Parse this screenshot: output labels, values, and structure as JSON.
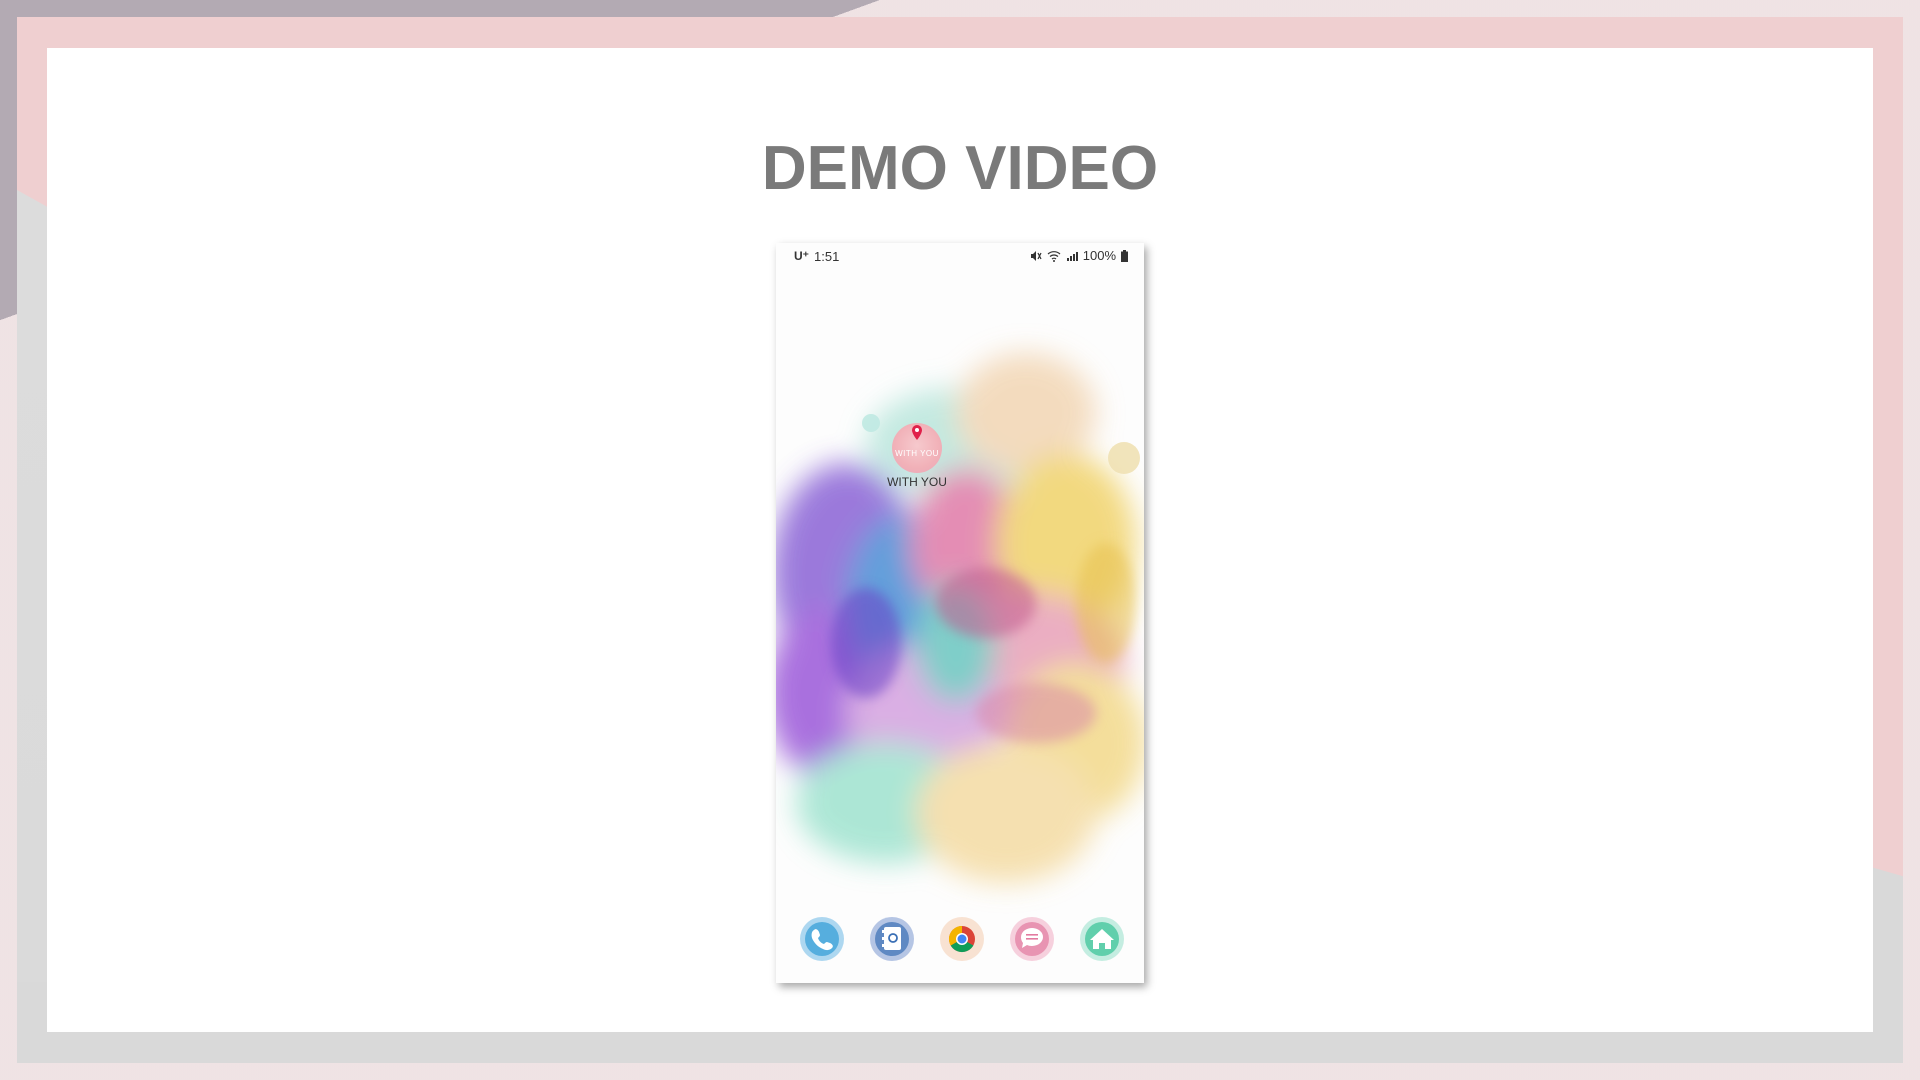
{
  "slide": {
    "title": "DEMO VIDEO"
  },
  "phone": {
    "status_bar": {
      "carrier": "U⁺",
      "time": "1:51",
      "battery": "100%"
    },
    "app": {
      "icon_text": "WITH YOU",
      "label": "WITH YOU"
    },
    "dock": [
      {
        "name": "phone",
        "icon": "phone-icon",
        "color": "#3aa0d8"
      },
      {
        "name": "contacts",
        "icon": "contacts-icon",
        "color": "#3a6fb5"
      },
      {
        "name": "chrome",
        "icon": "chrome-icon",
        "color": "#db4437"
      },
      {
        "name": "messages",
        "icon": "messages-icon",
        "color": "#e27aa0"
      },
      {
        "name": "home",
        "icon": "home-icon",
        "color": "#3fc49a"
      }
    ]
  },
  "colors": {
    "title": "#7a7a7a",
    "frame_pink": "#efcfd0",
    "frame_gray": "#d9d9d9",
    "outer": "#b3aab3"
  }
}
